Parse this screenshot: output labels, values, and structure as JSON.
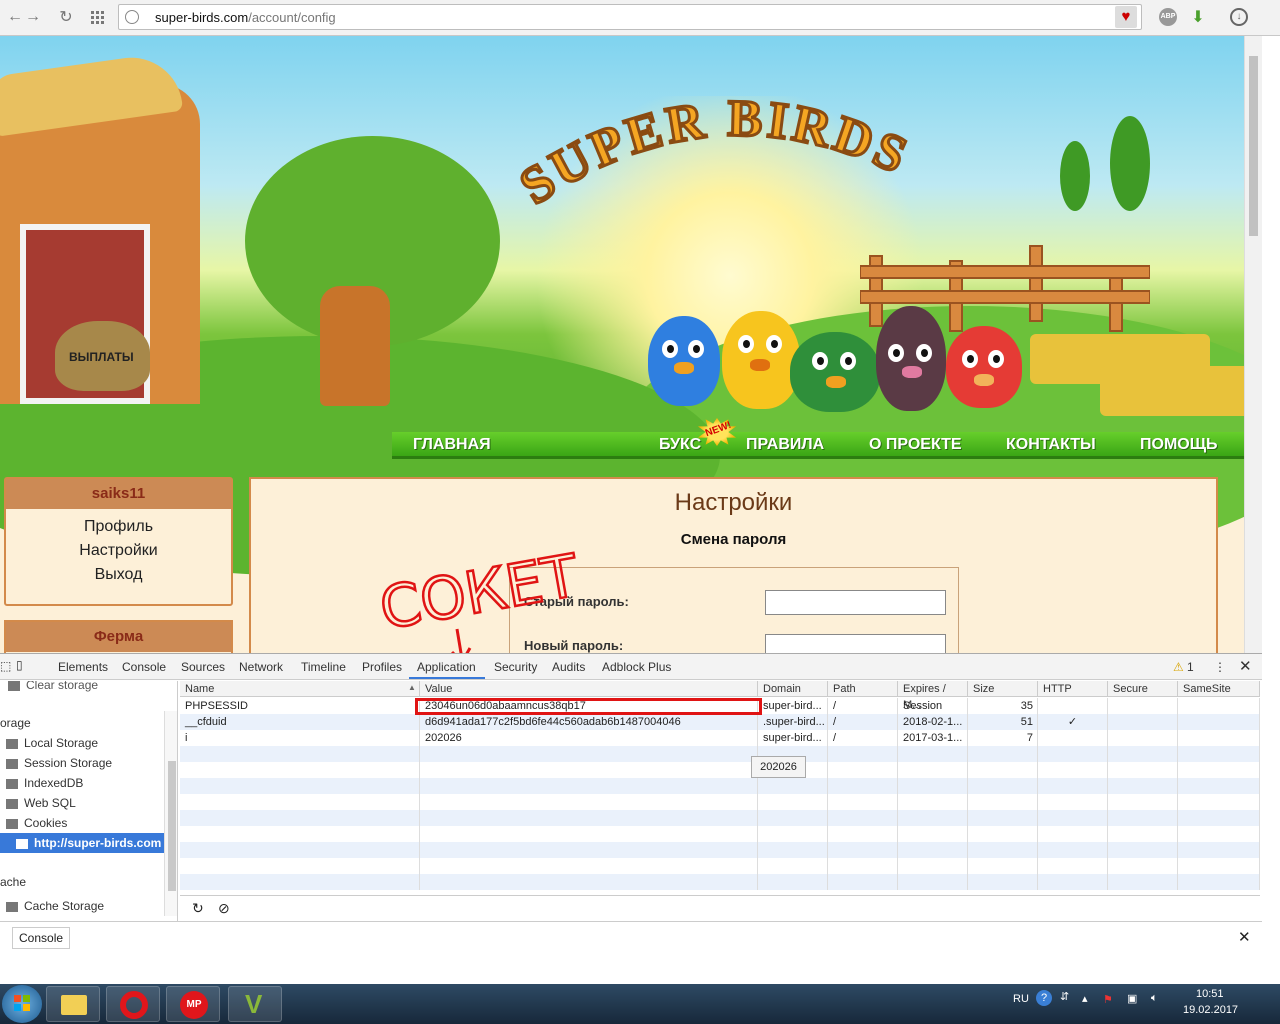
{
  "browser": {
    "url_host": "super-birds.com",
    "url_path": "/account/config",
    "abp_label": "ABP"
  },
  "site": {
    "logo_text": "SUPER BIRDS",
    "money_bag_label": "ВЫПЛАТЫ",
    "menu": [
      "ГЛАВНАЯ",
      "БУКС",
      "ПРАВИЛА",
      "О ПРОЕКТЕ",
      "КОНТАКТЫ",
      "ПОМОЩЬ"
    ],
    "new_badge": "NEW!",
    "user": {
      "name": "saiks11",
      "links": [
        "Профиль",
        "Настройки",
        "Выход"
      ]
    },
    "farm_title": "Ферма",
    "page_title": "Настройки",
    "section_title": "Смена пароля",
    "form": {
      "old_password_label": "Старый пароль:",
      "new_password_label": "Новый пароль:"
    },
    "annotation": "СОКЕТ"
  },
  "devtools": {
    "tabs": [
      "Elements",
      "Console",
      "Sources",
      "Network",
      "Timeline",
      "Profiles",
      "Application",
      "Security",
      "Audits",
      "Adblock Plus"
    ],
    "active_tab": "Application",
    "warning_count": "1",
    "sidebar": {
      "clear_storage": "Clear storage",
      "storage_header": "orage",
      "items": [
        "Local Storage",
        "Session Storage",
        "IndexedDB",
        "Web SQL",
        "Cookies"
      ],
      "selected": "http://super-birds.com",
      "cache_header": "ache",
      "cache_item": "Cache Storage"
    },
    "table": {
      "columns": [
        "Name",
        "Value",
        "Domain",
        "Path",
        "Expires / M...",
        "Size",
        "HTTP",
        "Secure",
        "SameSite"
      ],
      "rows": [
        {
          "name": "PHPSESSID",
          "value": "23046un06d0abaamncus38qb17",
          "domain": "super-bird...",
          "path": "/",
          "expires": "Session",
          "size": "35",
          "http": "",
          "secure": "",
          "samesite": ""
        },
        {
          "name": "__cfduid",
          "value": "d6d941ada177c2f5bd6fe44c560adab6b1487004046",
          "domain": ".super-bird...",
          "path": "/",
          "expires": "2018-02-1...",
          "size": "51",
          "http": "✓",
          "secure": "",
          "samesite": ""
        },
        {
          "name": "i",
          "value": "202026",
          "domain": "super-bird...",
          "path": "/",
          "expires": "2017-03-1...",
          "size": "7",
          "http": "",
          "secure": "",
          "samesite": ""
        }
      ]
    },
    "tooltip": "202026",
    "drawer_tab": "Console"
  },
  "taskbar": {
    "language": "RU",
    "time": "10:51",
    "date": "19.02.2017"
  }
}
